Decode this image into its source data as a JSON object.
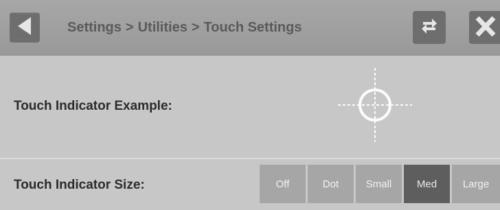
{
  "header": {
    "breadcrumb": [
      "Settings",
      "Utilities",
      "Touch Settings"
    ],
    "separator": ">"
  },
  "touch_indicator_example": {
    "label": "Touch Indicator Example:"
  },
  "touch_indicator_size": {
    "label": "Touch Indicator Size:",
    "options": [
      "Off",
      "Dot",
      "Small",
      "Med",
      "Large"
    ],
    "selected": "Med"
  },
  "colors": {
    "header_bg": "#a0a0a0",
    "button_bg": "#6e6e6e",
    "panel_bg": "#c7c7c7",
    "segment_bg": "#a6a6a6",
    "segment_active_bg": "#5e5e5e"
  }
}
